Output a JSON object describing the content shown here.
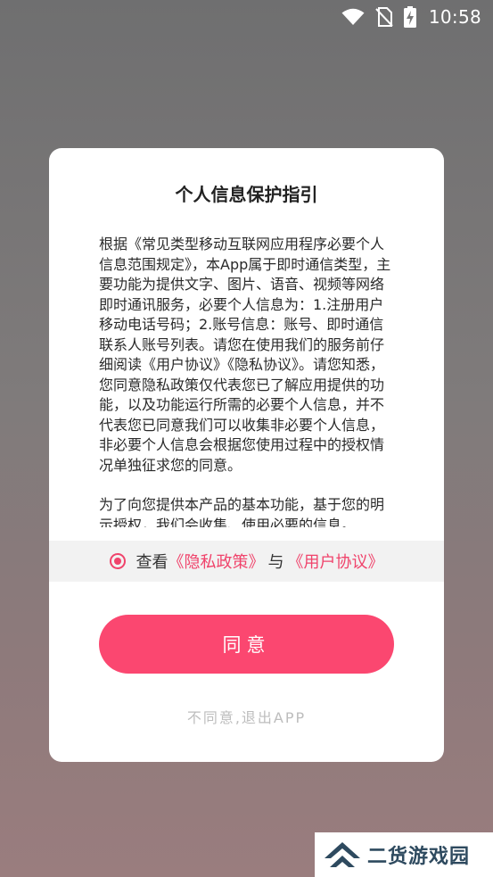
{
  "status_bar": {
    "time": "10:58",
    "icons": [
      "wifi-icon",
      "no-sim-icon",
      "battery-charging-icon"
    ]
  },
  "dialog": {
    "title": "个人信息保护指引",
    "paragraphs": [
      "根据《常见类型移动互联网应用程序必要个人信息范围规定》，本App属于即时通信类型，主要功能为提供文字、图片、语音、视频等网络即时通讯服务，必要个人信息为：1.注册用户移动电话号码；2.账号信息：账号、即时通信联系人账号列表。请您在使用我们的服务前仔细阅读《用户协议》《隐私协议》。请您知悉，您同意隐私政策仅代表您已了解应用提供的功能，以及功能运行所需的必要个人信息，并不代表您已同意我们可以收集非必要个人信息，非必要个人信息会根据您使用过程中的授权情况单独征求您的同意。",
      "为了向您提供本产品的基本功能，基于您的明示授权，我们会收集、使用必要的信息。"
    ],
    "consent": {
      "prefix": "查看",
      "privacy_link": "《隐私政策》",
      "connector": "与",
      "agreement_link": "《用户协议》",
      "checked": true
    },
    "agree_label": "同意",
    "disagree_label": "不同意,退出APP"
  },
  "watermark": {
    "text": "二货游戏园"
  },
  "colors": {
    "accent": "#fb4770",
    "link": "#f0436b",
    "muted": "#bdbdbd"
  }
}
